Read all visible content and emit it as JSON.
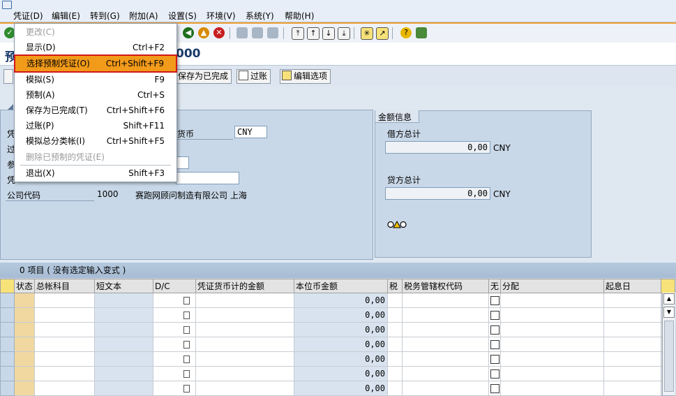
{
  "menubar": {
    "items": [
      "凭证(D)",
      "编辑(E)",
      "转到(G)",
      "附加(A)",
      "设置(S)",
      "环境(V)",
      "系统(Y)",
      "帮助(H)"
    ]
  },
  "title": {
    "left": "预",
    "right": "000"
  },
  "app_toolbar": {
    "save_completed": "保存为已完成",
    "post": "过账",
    "edit_options": "编辑选项"
  },
  "dropdown": {
    "items": [
      {
        "label": "更改(C)",
        "shortcut": "",
        "state": "disabled"
      },
      {
        "label": "显示(D)",
        "shortcut": "Ctrl+F2",
        "state": "normal"
      },
      {
        "label": "选择预制凭证(O)",
        "shortcut": "Ctrl+Shift+F9",
        "state": "selected"
      },
      {
        "label": "模拟(S)",
        "shortcut": "F9",
        "state": "normal"
      },
      {
        "label": "预制(A)",
        "shortcut": "Ctrl+S",
        "state": "normal"
      },
      {
        "label": "保存为已完成(T)",
        "shortcut": "Ctrl+Shift+F6",
        "state": "normal"
      },
      {
        "label": "过账(P)",
        "shortcut": "Shift+F11",
        "state": "normal"
      },
      {
        "label": "模拟总分类帐(I)",
        "shortcut": "Ctrl+Shift+F5",
        "state": "normal"
      },
      {
        "label": "删除已预制的凭证(E)",
        "shortcut": "",
        "state": "disabled"
      },
      {
        "label": "退出(X)",
        "shortcut": "Shift+F3",
        "state": "normal"
      }
    ]
  },
  "header_panel": {
    "label_fragments": [
      "凭",
      "过",
      "参",
      "凭"
    ],
    "currency_label": "货币",
    "currency_value": "CNY",
    "company_code_label": "公司代码",
    "company_code_value": "1000",
    "company_name": "赛跑网顾问制造有限公司 上海"
  },
  "amount_panel": {
    "title": "金额信息",
    "debit_label": "借方总计",
    "debit_value": "0,00",
    "debit_currency": "CNY",
    "credit_label": "贷方总计",
    "credit_value": "0,00",
    "credit_currency": "CNY"
  },
  "grid": {
    "title": "0 项目 ( 没有选定输入变式 )",
    "columns": [
      "状态",
      "总帐科目",
      "短文本",
      "D/C",
      "凭证货币计的金额",
      "本位币金额",
      "税",
      "税务管辖权代码",
      "无",
      "分配",
      "起息日"
    ],
    "rows": [
      {
        "local_amount": "0,00"
      },
      {
        "local_amount": "0,00"
      },
      {
        "local_amount": "0,00"
      },
      {
        "local_amount": "0,00"
      },
      {
        "local_amount": "0,00"
      },
      {
        "local_amount": "0,00"
      },
      {
        "local_amount": "0,00"
      }
    ]
  },
  "colors": {
    "selected_bg": "#f29a1a",
    "selected_border": "#d01818",
    "panel_bg": "#c9d8e8"
  }
}
